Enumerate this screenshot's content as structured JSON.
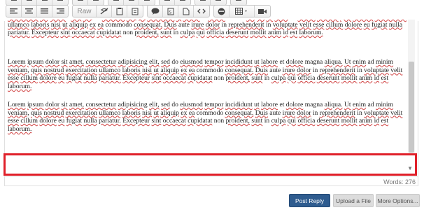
{
  "toolbar": {
    "raw_label": "Raw"
  },
  "editor": {
    "paragraphs": [
      "consectetur adipisicing elit, sed do eiusmod tempor incididunt ut labore et dolore magna aliqua. Ut enim ad minim veniam, quis nostrud exercitation ullamco laboris nisi ut aliquip ex ea commodo consequat. Duis aute irure dolor in reprehenderit in voluptate velit esse cillum dolore eu fugiat nulla pariatur. Excepteur sint occaecat cupidatat non proident, sunt in culpa qui officia deserunt mollit anim id est laborum.",
      "Lorem ipsum dolor sit amet, consectetur adipisicing elit, sed do eiusmod tempor incididunt ut labore et dolore magna aliqua. Ut enim ad minim veniam, quis nostrud exercitation ullamco laboris nisi ut aliquip ex ea commodo consequat. Duis aute irure dolor in reprehenderit in voluptate velit esse cillum dolore eu fugiat nulla pariatur. Excepteur sint occaecat cupidatat non proident, sunt in culpa qui officia deserunt mollit anim id est laborum.",
      "Lorem ipsum dolor sit amet, consectetur adipisicing elit, sed do eiusmod tempor incididunt ut labore et dolore magna aliqua. Ut enim ad minim veniam, quis nostrud exercitation ullamco laboris nisi ut aliquip ex ea commodo consequat. Duis aute irure dolor in reprehenderit in voluptate velit esse cillum dolore eu fugiat nulla pariatur. Excepteur sint occaecat cupidatat non proident, sunt in culpa qui officia deserunt mollit anim id est laborum."
    ]
  },
  "footer": {
    "word_count": "Words: 276"
  },
  "actions": {
    "post_reply": "Post Reply",
    "upload_file": "Upload a File",
    "more_options": "More Options..."
  },
  "colors": {
    "primary_button": "#2f5c8f",
    "highlight_border": "#e0202a",
    "spellcheck_underline": "#d04040"
  }
}
